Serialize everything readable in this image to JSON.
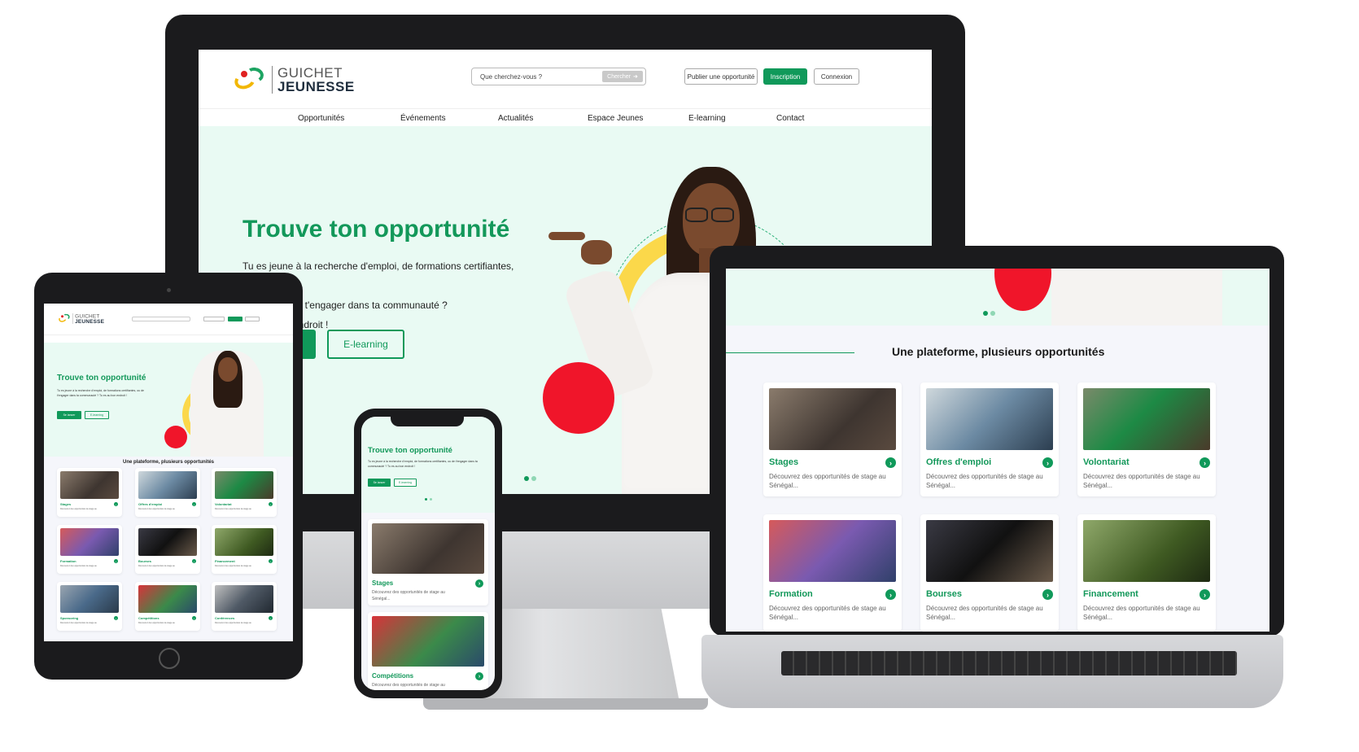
{
  "brand": {
    "line1": "GUICHET",
    "line2": "JEUNESSE"
  },
  "header": {
    "search_placeholder": "Que cherchez-vous ?",
    "search_button": "Chercher",
    "publish_button": "Publier une opportunité",
    "signup_button": "Inscription",
    "login_button": "Connexion"
  },
  "nav": [
    "Opportunités",
    "Événements",
    "Actualités",
    "Espace Jeunes",
    "E-learning",
    "Contact"
  ],
  "hero": {
    "title": "Trouve ton opportunité",
    "text_line1": "Tu es jeune à la recherche d'emploi, de formations certifiantes, ou",
    "text_line2": "de t'engager dans ta communauté ?",
    "text_line3": "endroit !",
    "cta_primary_partial": "n",
    "cta_secondary": "E-learning"
  },
  "section": {
    "title": "Une plateforme, plusieurs opportunités"
  },
  "cards": [
    {
      "title": "Stages",
      "desc_line1": "Découvrez des opportunités de stage au",
      "desc_line2": "Sénégal..."
    },
    {
      "title": "Offres d'emploi",
      "desc_line1": "Découvrez des opportunités de stage au",
      "desc_line2": "Sénégal..."
    },
    {
      "title": "Volontariat",
      "desc_line1": "Découvrez des opportunités de stage au",
      "desc_line2": "Sénégal..."
    },
    {
      "title": "Formation",
      "desc_line1": "Découvrez des opportunités de stage au",
      "desc_line2": "Sénégal..."
    },
    {
      "title": "Bourses",
      "desc_line1": "Découvrez des opportunités de stage au",
      "desc_line2": "Sénégal..."
    },
    {
      "title": "Financement",
      "desc_line1": "Découvrez des opportunités de stage au",
      "desc_line2": "Sénégal..."
    },
    {
      "title": "Sponsoring",
      "desc_line1": "Découvrez des opportunités de stage au",
      "desc_line2": "Sénégal..."
    },
    {
      "title": "Compétitions",
      "desc_line1": "Découvrez des opportunités de stage au",
      "desc_line2": "Sénégal..."
    },
    {
      "title": "Conférences",
      "desc_line1": "Découvrez des opportunités de stage au",
      "desc_line2": "Sénégal..."
    }
  ],
  "mobile": {
    "hero_title": "Trouve ton opportunité",
    "hero_text": "Tu es jeune à la recherche d'emploi, de formations certifiantes, ou de t'engager dans ta communauté ? Tu es au bon endroit !",
    "btn_primary": "Se lancer",
    "btn_secondary": "E-learning"
  },
  "colors": {
    "primary": "#10995a",
    "accent_red": "#f0152a",
    "accent_yellow": "#fbd84a",
    "hero_bg": "#e9faf3"
  },
  "icons": [
    "arrow-right-icon",
    "chevron-right-icon",
    "logo-mark-icon"
  ]
}
